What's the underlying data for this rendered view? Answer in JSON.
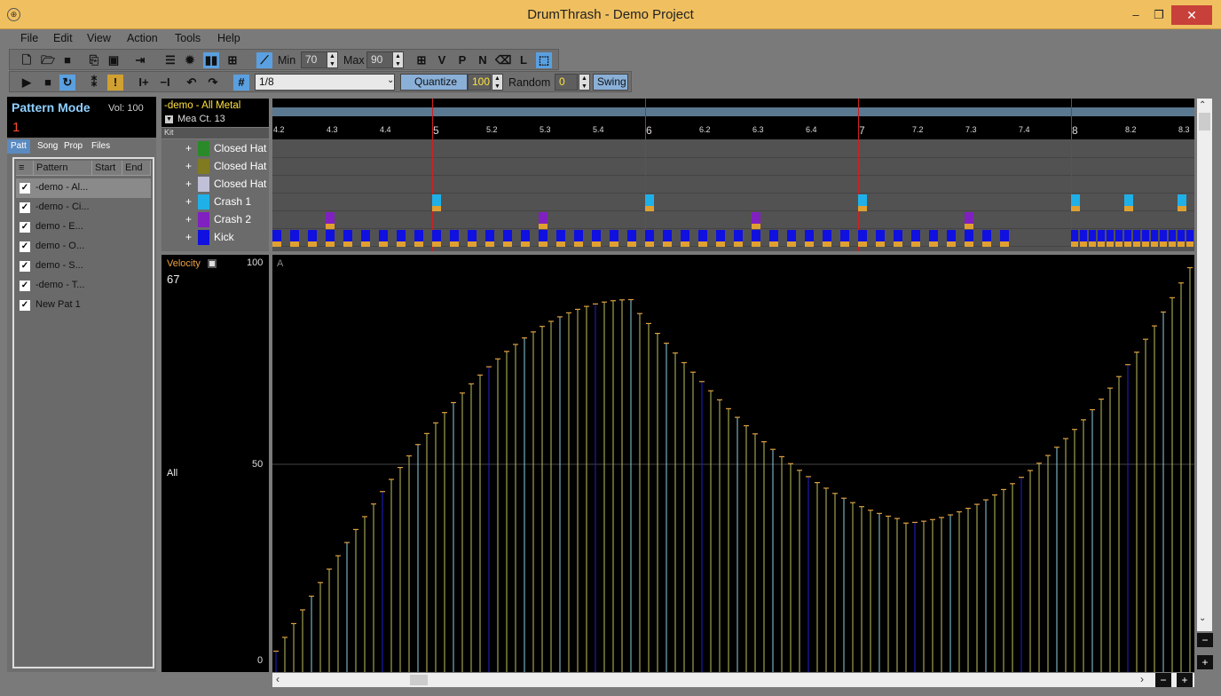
{
  "window": {
    "title": "DrumThrash - Demo Project",
    "min": "–",
    "restore": "❐",
    "close": "✕"
  },
  "menu": [
    "File",
    "Edit",
    "View",
    "Action",
    "Tools",
    "Help"
  ],
  "toolbar": {
    "min_label": "Min",
    "min_value": "70",
    "max_label": "Max",
    "max_value": "90",
    "snap_value": "1/8",
    "quantize_label": "Quantize",
    "quantize_value": "100",
    "random_label": "Random",
    "random_value": "0",
    "swing_label": "Swing"
  },
  "pattern_mode": {
    "title": "Pattern Mode",
    "vol_label": "Vol: 100",
    "number": "1",
    "tabs": [
      "Patt",
      "Song",
      "Prop",
      "Files"
    ]
  },
  "pattern_list": {
    "headers": [
      "≡",
      "Pattern",
      "Start",
      "End"
    ],
    "rows": [
      "-demo - Al...",
      "-demo - Ci...",
      "demo - E...",
      "demo - O...",
      "demo - S...",
      "-demo - T...",
      "New Pat 1"
    ]
  },
  "pattern_header": {
    "name": "-demo - All Metal",
    "mea": "Mea Ct. 13",
    "kit_label": "Kit"
  },
  "kit": [
    {
      "name": "Closed Hat",
      "color": "#2a8a2a"
    },
    {
      "name": "Closed Hat",
      "color": "#807a20"
    },
    {
      "name": "Closed Hat",
      "color": "#c0c0d8"
    },
    {
      "name": "Crash 1",
      "color": "#20b0e8"
    },
    {
      "name": "Crash 2",
      "color": "#8020c0"
    },
    {
      "name": "Kick",
      "color": "#1010e0"
    }
  ],
  "ruler": [
    "4.2",
    "4.3",
    "4.4",
    "5",
    "5.2",
    "5.3",
    "5.4",
    "6",
    "6.2",
    "6.3",
    "6.4",
    "7",
    "7.2",
    "7.3",
    "7.4",
    "8",
    "8.2",
    "8.3"
  ],
  "velocity": {
    "label": "Velocity",
    "value": "67",
    "all_label": "All",
    "top": "100",
    "mid": "50",
    "bottom": "0",
    "corner": "A"
  }
}
